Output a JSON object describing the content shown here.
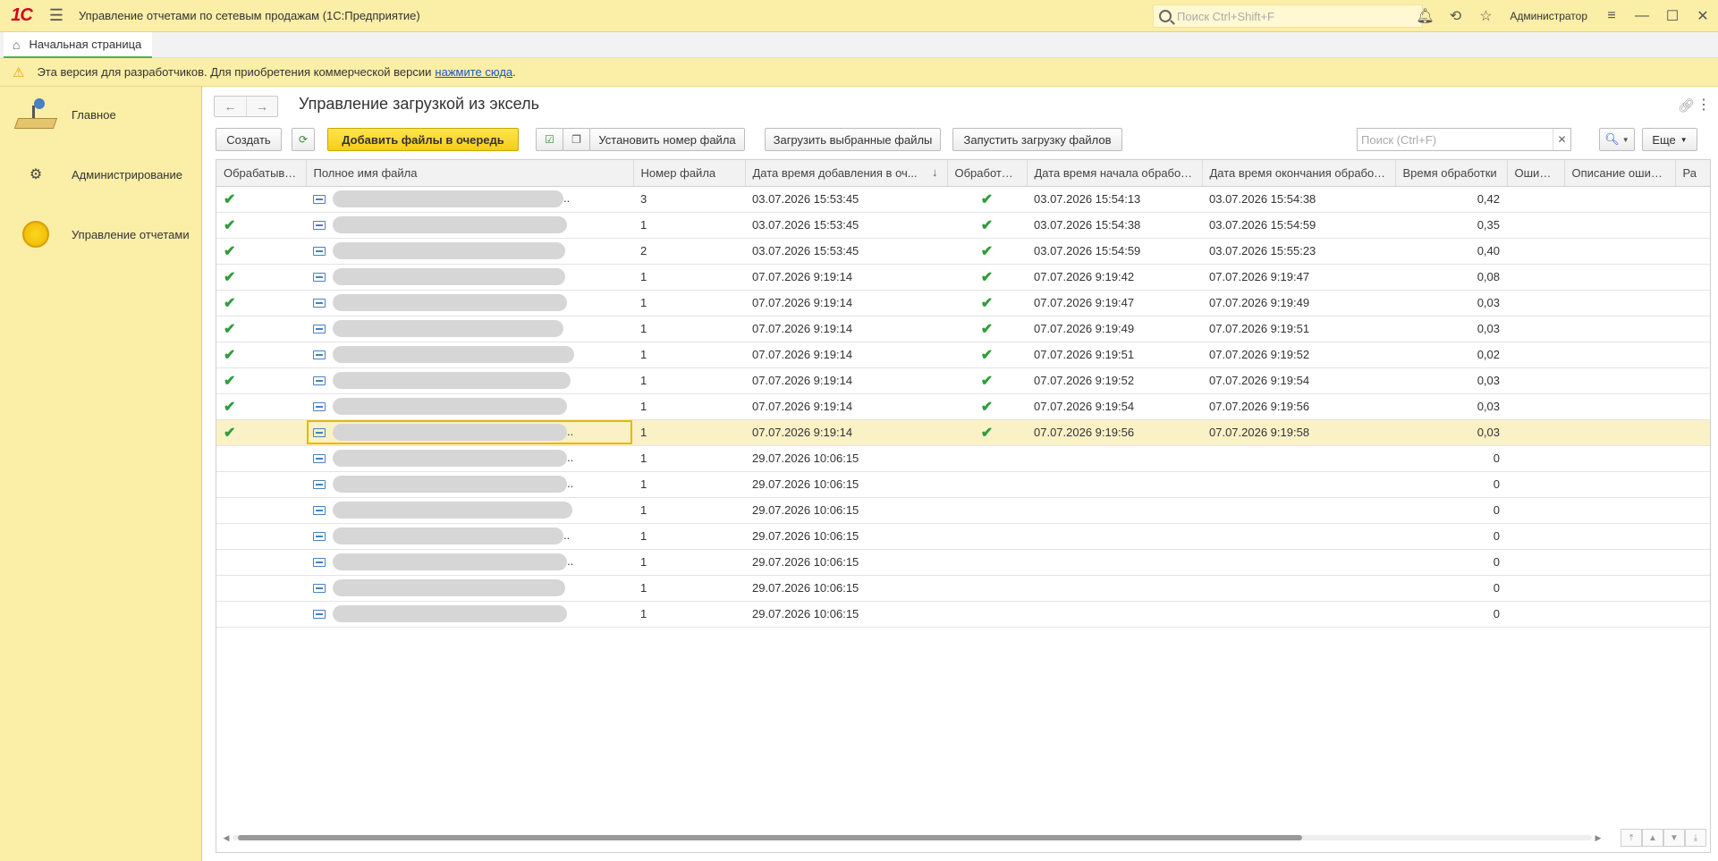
{
  "window": {
    "app_title": "Управление отчетами по сетевым продажам  (1С:Предприятие)",
    "search_placeholder": "Поиск Ctrl+Shift+F",
    "user": "Администратор",
    "logo_text": "1С"
  },
  "tabs": {
    "home_label": "Начальная страница"
  },
  "banner": {
    "text": "Эта версия для разработчиков. Для приобретения коммерческой версии",
    "link": "нажмите сюда",
    "suffix": "."
  },
  "sidebar": {
    "items": [
      {
        "label": "Главное",
        "icon": "desk-lamp-icon"
      },
      {
        "label": "Администрирование",
        "icon": "gear-icon"
      },
      {
        "label": "Управление отчетами",
        "icon": "yellow-circle-icon"
      }
    ]
  },
  "form": {
    "title": "Управление загрузкой из эксель",
    "toolbar": {
      "create": "Создать",
      "add_files": "Добавить файлы в очередь",
      "set_number": "Установить номер файла",
      "load_selected": "Загрузить выбранные файлы",
      "start_load": "Запустить загрузку файлов",
      "more": "Еще",
      "search_placeholder": "Поиск (Ctrl+F)"
    },
    "columns": [
      "Обрабатывать",
      "Полное имя файла",
      "Номер файла",
      "Дата время добавления в оч...",
      "Обработано",
      "Дата время начала обработки",
      "Дата время окончания обработки",
      "Время обработки",
      "Ошибка",
      "Описание ошибки",
      "Ра"
    ],
    "rows": [
      {
        "process": true,
        "num": "3",
        "added": "03.07.2026 15:53:45",
        "done": true,
        "start": "03.07.2026 15:54:13",
        "end": "03.07.2026 15:54:38",
        "time": "0,42",
        "ellipsis": true
      },
      {
        "process": true,
        "num": "1",
        "added": "03.07.2026 15:53:45",
        "done": true,
        "start": "03.07.2026 15:54:38",
        "end": "03.07.2026 15:54:59",
        "time": "0,35"
      },
      {
        "process": true,
        "num": "2",
        "added": "03.07.2026 15:53:45",
        "done": true,
        "start": "03.07.2026 15:54:59",
        "end": "03.07.2026 15:55:23",
        "time": "0,40"
      },
      {
        "process": true,
        "num": "1",
        "added": "07.07.2026 9:19:14",
        "done": true,
        "start": "07.07.2026 9:19:42",
        "end": "07.07.2026 9:19:47",
        "time": "0,08"
      },
      {
        "process": true,
        "num": "1",
        "added": "07.07.2026 9:19:14",
        "done": true,
        "start": "07.07.2026 9:19:47",
        "end": "07.07.2026 9:19:49",
        "time": "0,03"
      },
      {
        "process": true,
        "num": "1",
        "added": "07.07.2026 9:19:14",
        "done": true,
        "start": "07.07.2026 9:19:49",
        "end": "07.07.2026 9:19:51",
        "time": "0,03"
      },
      {
        "process": true,
        "num": "1",
        "added": "07.07.2026 9:19:14",
        "done": true,
        "start": "07.07.2026 9:19:51",
        "end": "07.07.2026 9:19:52",
        "time": "0,02"
      },
      {
        "process": true,
        "num": "1",
        "added": "07.07.2026 9:19:14",
        "done": true,
        "start": "07.07.2026 9:19:52",
        "end": "07.07.2026 9:19:54",
        "time": "0,03"
      },
      {
        "process": true,
        "num": "1",
        "added": "07.07.2026 9:19:14",
        "done": true,
        "start": "07.07.2026 9:19:54",
        "end": "07.07.2026 9:19:56",
        "time": "0,03"
      },
      {
        "process": true,
        "num": "1",
        "added": "07.07.2026 9:19:14",
        "done": true,
        "start": "07.07.2026 9:19:56",
        "end": "07.07.2026 9:19:58",
        "time": "0,03",
        "selected": true,
        "ellipsis": true
      },
      {
        "process": false,
        "num": "1",
        "added": "29.07.2026 10:06:15",
        "done": false,
        "start": "",
        "end": "",
        "time": "0",
        "ellipsis": true
      },
      {
        "process": false,
        "num": "1",
        "added": "29.07.2026 10:06:15",
        "done": false,
        "start": "",
        "end": "",
        "time": "0",
        "ellipsis": true
      },
      {
        "process": false,
        "num": "1",
        "added": "29.07.2026 10:06:15",
        "done": false,
        "start": "",
        "end": "",
        "time": "0"
      },
      {
        "process": false,
        "num": "1",
        "added": "29.07.2026 10:06:15",
        "done": false,
        "start": "",
        "end": "",
        "time": "0",
        "ellipsis": true
      },
      {
        "process": false,
        "num": "1",
        "added": "29.07.2026 10:06:15",
        "done": false,
        "start": "",
        "end": "",
        "time": "0",
        "ellipsis": true
      },
      {
        "process": false,
        "num": "1",
        "added": "29.07.2026 10:06:15",
        "done": false,
        "start": "",
        "end": "",
        "time": "0"
      },
      {
        "process": false,
        "num": "1",
        "added": "29.07.2026 10:06:15",
        "done": false,
        "start": "",
        "end": "",
        "time": "0"
      }
    ]
  },
  "colors": {
    "accent_yellow": "#fbeea7",
    "primary_button": "#f5cc1c",
    "check_green": "#2e9d3b",
    "selected_row": "#fbf1c7",
    "link": "#1a56c4"
  }
}
